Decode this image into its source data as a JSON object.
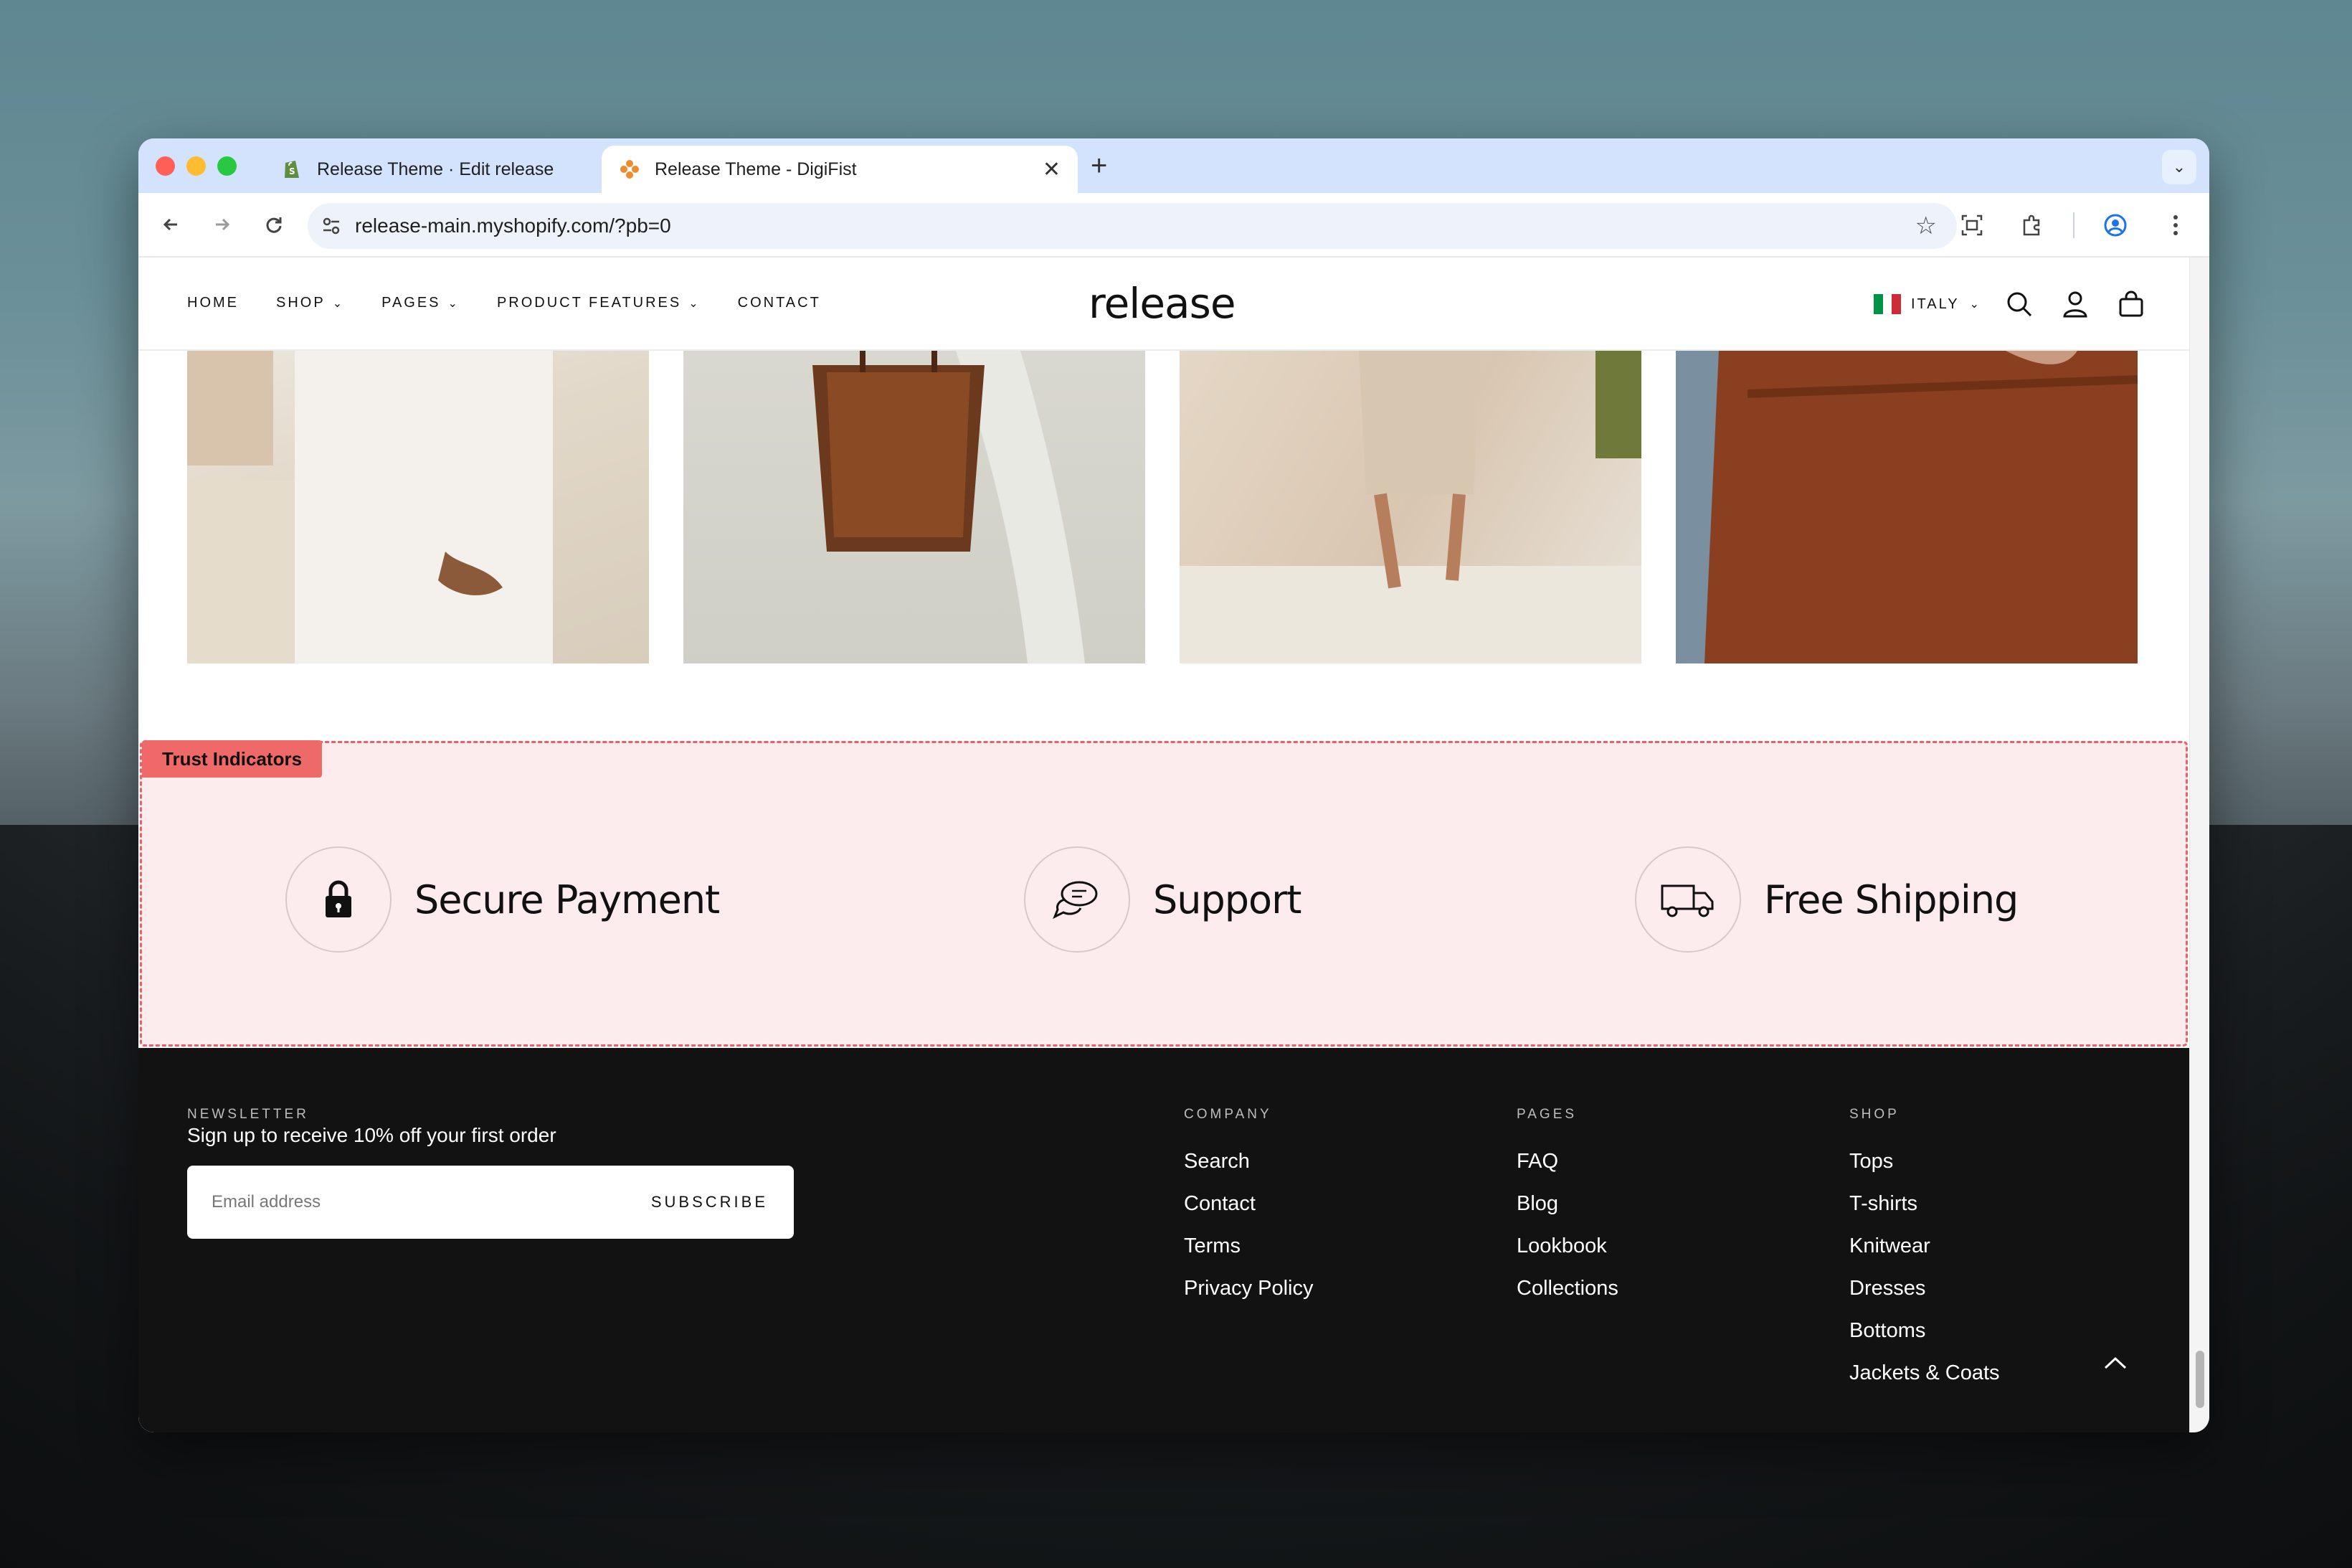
{
  "browser": {
    "tabs": [
      {
        "title": "Release Theme · Edit release",
        "favicon": "shopify-icon",
        "active": false
      },
      {
        "title": "Release Theme - DigiFist",
        "favicon": "digifist-icon",
        "active": true
      }
    ],
    "new_tab": "+",
    "url": "release-main.myshopify.com/?pb=0"
  },
  "header": {
    "nav": [
      {
        "label": "HOME",
        "has_dropdown": false
      },
      {
        "label": "SHOP",
        "has_dropdown": true
      },
      {
        "label": "PAGES",
        "has_dropdown": true
      },
      {
        "label": "PRODUCT FEATURES",
        "has_dropdown": true
      },
      {
        "label": "CONTACT",
        "has_dropdown": false
      }
    ],
    "logo": "release",
    "country": "ITALY",
    "icons": [
      "search-icon",
      "account-icon",
      "cart-icon"
    ]
  },
  "trust": {
    "tag": "Trust Indicators",
    "items": [
      {
        "label": "Secure Payment",
        "icon": "lock-icon"
      },
      {
        "label": "Support",
        "icon": "chat-bubbles-icon"
      },
      {
        "label": "Free Shipping",
        "icon": "truck-icon"
      }
    ]
  },
  "footer": {
    "newsletter": {
      "kicker": "NEWSLETTER",
      "text": "Sign up to receive 10% off your first order",
      "placeholder": "Email address",
      "button": "SUBSCRIBE"
    },
    "columns": [
      {
        "title": "COMPANY",
        "links": [
          "Search",
          "Contact",
          "Terms",
          "Privacy Policy"
        ]
      },
      {
        "title": "PAGES",
        "links": [
          "FAQ",
          "Blog",
          "Lookbook",
          "Collections"
        ]
      },
      {
        "title": "SHOP",
        "links": [
          "Tops",
          "T-shirts",
          "Knitwear",
          "Dresses",
          "Bottoms",
          "Jackets & Coats"
        ]
      }
    ]
  },
  "colors": {
    "tab_strip": "#d3e3fd",
    "trust_bg": "#fdeced",
    "trust_border": "#e8606a",
    "tag_bg": "#f06969",
    "footer_bg": "#121212"
  }
}
